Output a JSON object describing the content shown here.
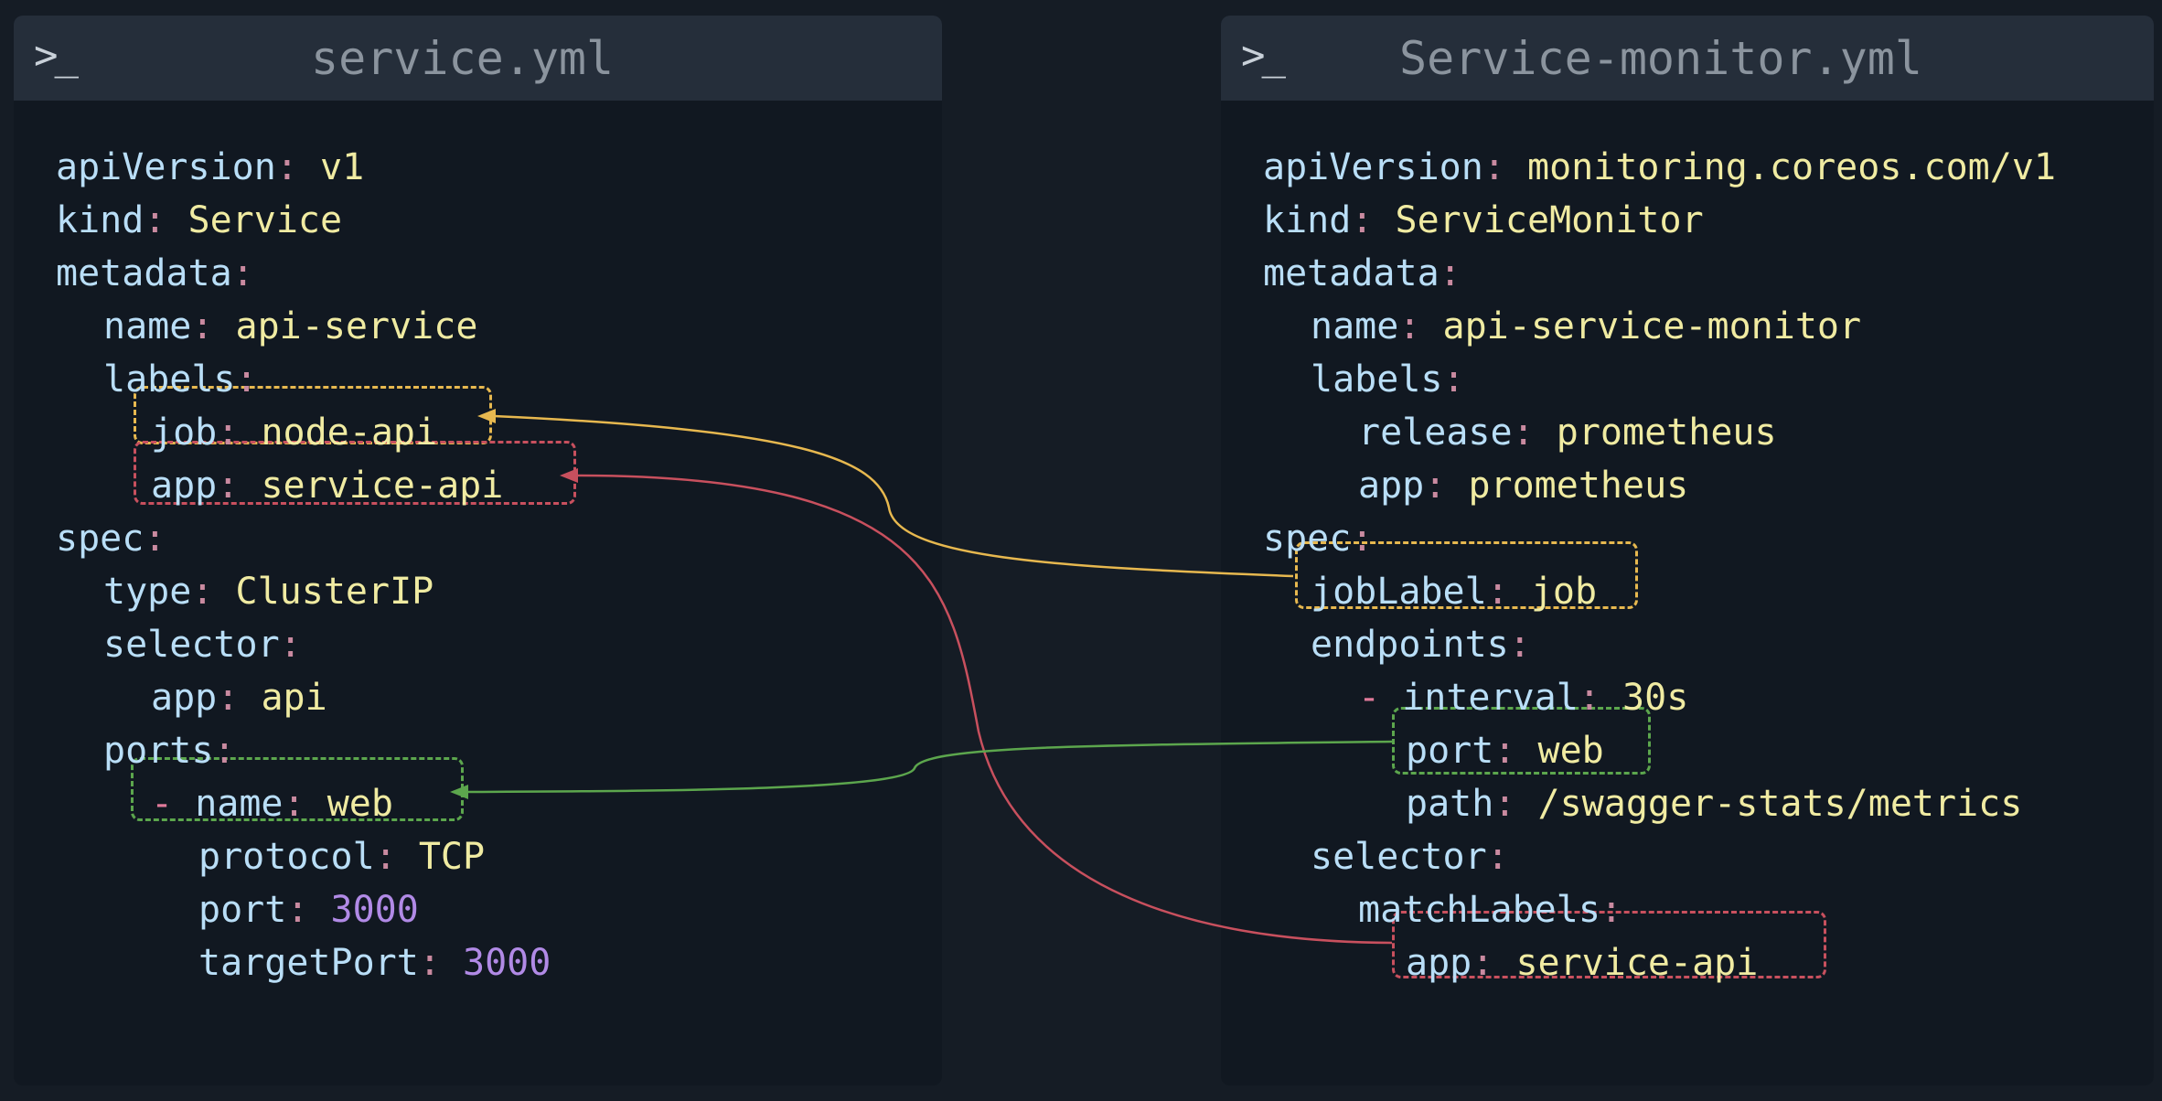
{
  "left_file": {
    "prompt": ">_",
    "title": "service.yml",
    "lines": {
      "l1": {
        "key": "apiVersion",
        "colon": ":",
        "value": "v1"
      },
      "l2": {
        "key": "kind",
        "colon": ":",
        "value": "Service"
      },
      "l3": {
        "key": "metadata",
        "colon": ":"
      },
      "l4": {
        "key": "name",
        "colon": ":",
        "value": "api-service"
      },
      "l5": {
        "key": "labels",
        "colon": ":"
      },
      "l6": {
        "key": "job",
        "colon": ":",
        "value": "node-api"
      },
      "l7": {
        "key": "app",
        "colon": ":",
        "value": "service-api"
      },
      "l8": {
        "key": "spec",
        "colon": ":"
      },
      "l9": {
        "key": "type",
        "colon": ":",
        "value": "ClusterIP"
      },
      "l10": {
        "key": "selector",
        "colon": ":"
      },
      "l11": {
        "key": "app",
        "colon": ":",
        "value": "api"
      },
      "l12": {
        "key": "ports",
        "colon": ":"
      },
      "l13": {
        "dash": "-",
        "key": "name",
        "colon": ":",
        "value": "web"
      },
      "l14": {
        "key": "protocol",
        "colon": ":",
        "value": "TCP"
      },
      "l15": {
        "key": "port",
        "colon": ":",
        "value": "3000"
      },
      "l16": {
        "key": "targetPort",
        "colon": ":",
        "value": "3000"
      }
    }
  },
  "right_file": {
    "prompt": ">_",
    "title": "Service-monitor.yml",
    "lines": {
      "l1": {
        "key": "apiVersion",
        "colon": ":",
        "value": "monitoring.coreos.com/v1"
      },
      "l2": {
        "key": "kind",
        "colon": ":",
        "value": "ServiceMonitor"
      },
      "l3": {
        "key": "metadata",
        "colon": ":"
      },
      "l4": {
        "key": "name",
        "colon": ":",
        "value": "api-service-monitor"
      },
      "l5": {
        "key": "labels",
        "colon": ":"
      },
      "l6": {
        "key": "release",
        "colon": ":",
        "value": "prometheus"
      },
      "l7": {
        "key": "app",
        "colon": ":",
        "value": "prometheus"
      },
      "l8": {
        "key": "spec",
        "colon": ":"
      },
      "l9": {
        "key": "jobLabel",
        "colon": ":",
        "value": "job"
      },
      "l10": {
        "key": "endpoints",
        "colon": ":"
      },
      "l11": {
        "dash": "-",
        "key": "interval",
        "colon": ":",
        "value": "30s"
      },
      "l12": {
        "key": "port",
        "colon": ":",
        "value": "web"
      },
      "l13": {
        "key": "path",
        "colon": ":",
        "value": "/swagger-stats/metrics"
      },
      "l14": {
        "key": "selector",
        "colon": ":"
      },
      "l15": {
        "key": "matchLabels",
        "colon": ":"
      },
      "l16": {
        "key": "app",
        "colon": ":",
        "value": "service-api"
      }
    }
  },
  "colors": {
    "job_link": "#e7b84f",
    "app_link": "#c8505e",
    "port_link": "#5ca64d"
  }
}
